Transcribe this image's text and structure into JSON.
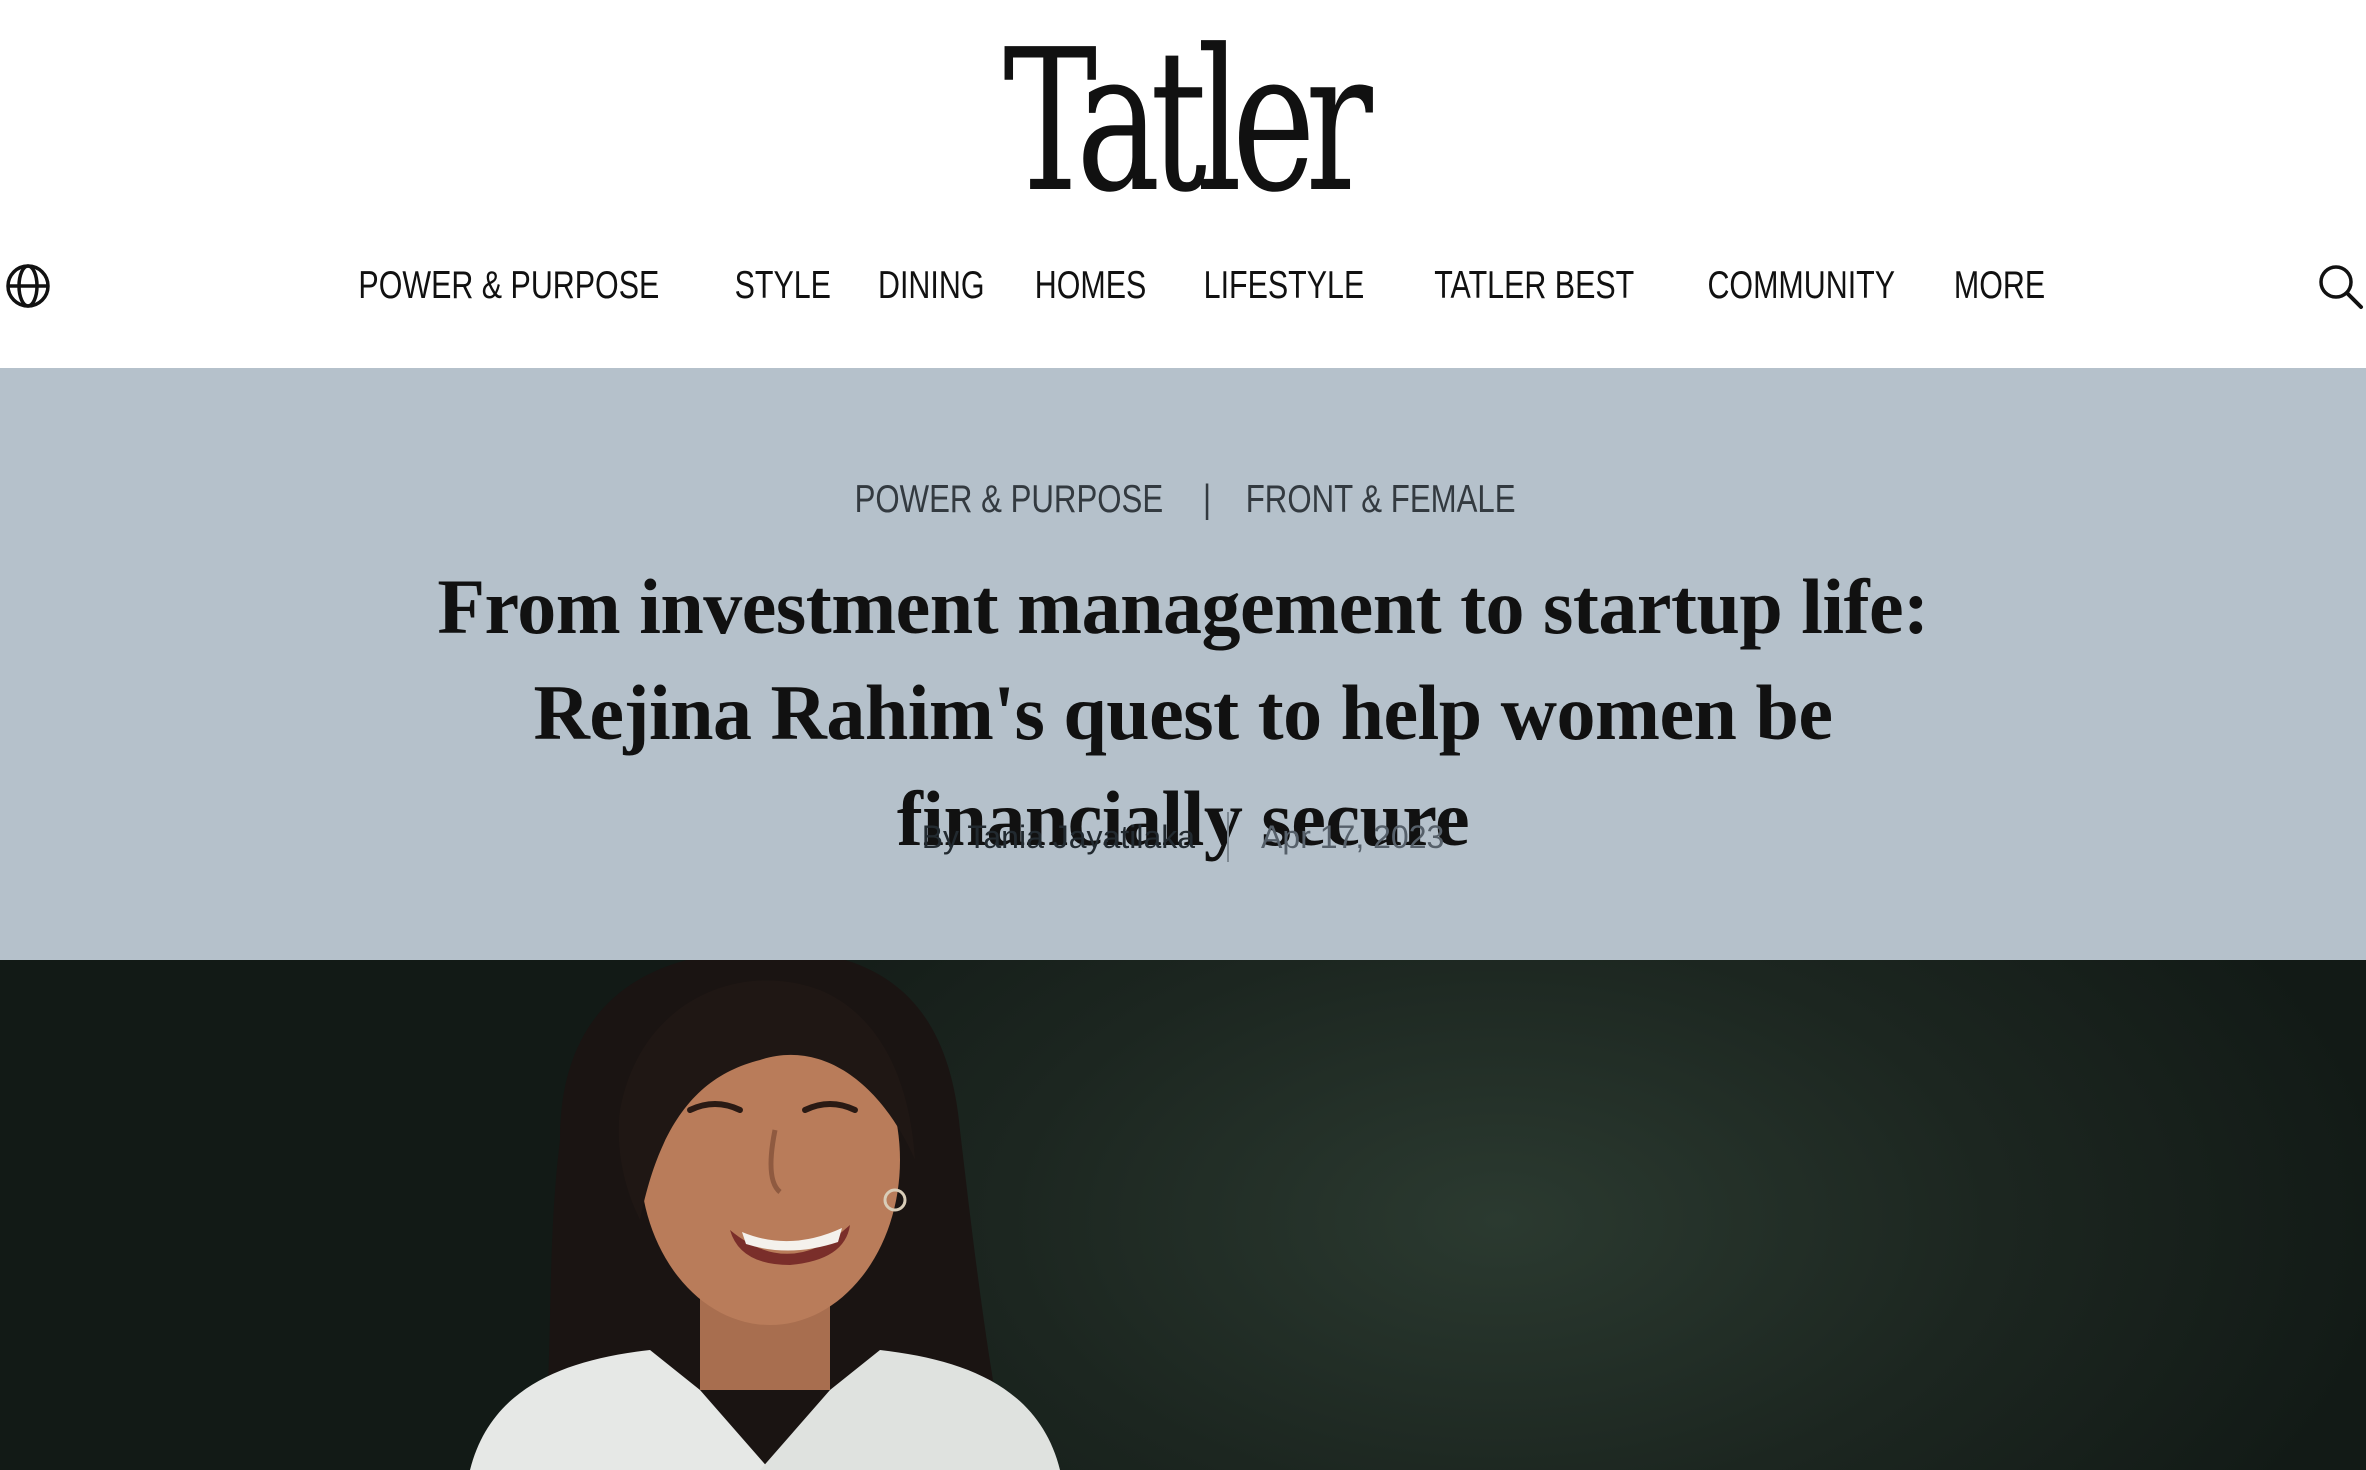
{
  "header": {
    "logo_text": "Tatler",
    "globe_icon": "globe-icon",
    "search_icon": "search-icon"
  },
  "nav": {
    "items": [
      {
        "label": "POWER & PURPOSE"
      },
      {
        "label": "STYLE"
      },
      {
        "label": "DINING"
      },
      {
        "label": "HOMES"
      },
      {
        "label": "LIFESTYLE"
      },
      {
        "label": "TATLER BEST"
      },
      {
        "label": "COMMUNITY"
      },
      {
        "label": "MORE"
      }
    ]
  },
  "article": {
    "category": "POWER & PURPOSE",
    "separator": "|",
    "subcategory": "FRONT & FEMALE",
    "headline": "From investment management to startup life: Rejina Rahim's quest to help women be financially secure",
    "byline": "By Tania Jayatilaka",
    "date": "Apr 17, 2023"
  },
  "colors": {
    "hero_background": "#b5c1cb",
    "photo_background": "#1f2a24",
    "text_primary": "#111111"
  }
}
